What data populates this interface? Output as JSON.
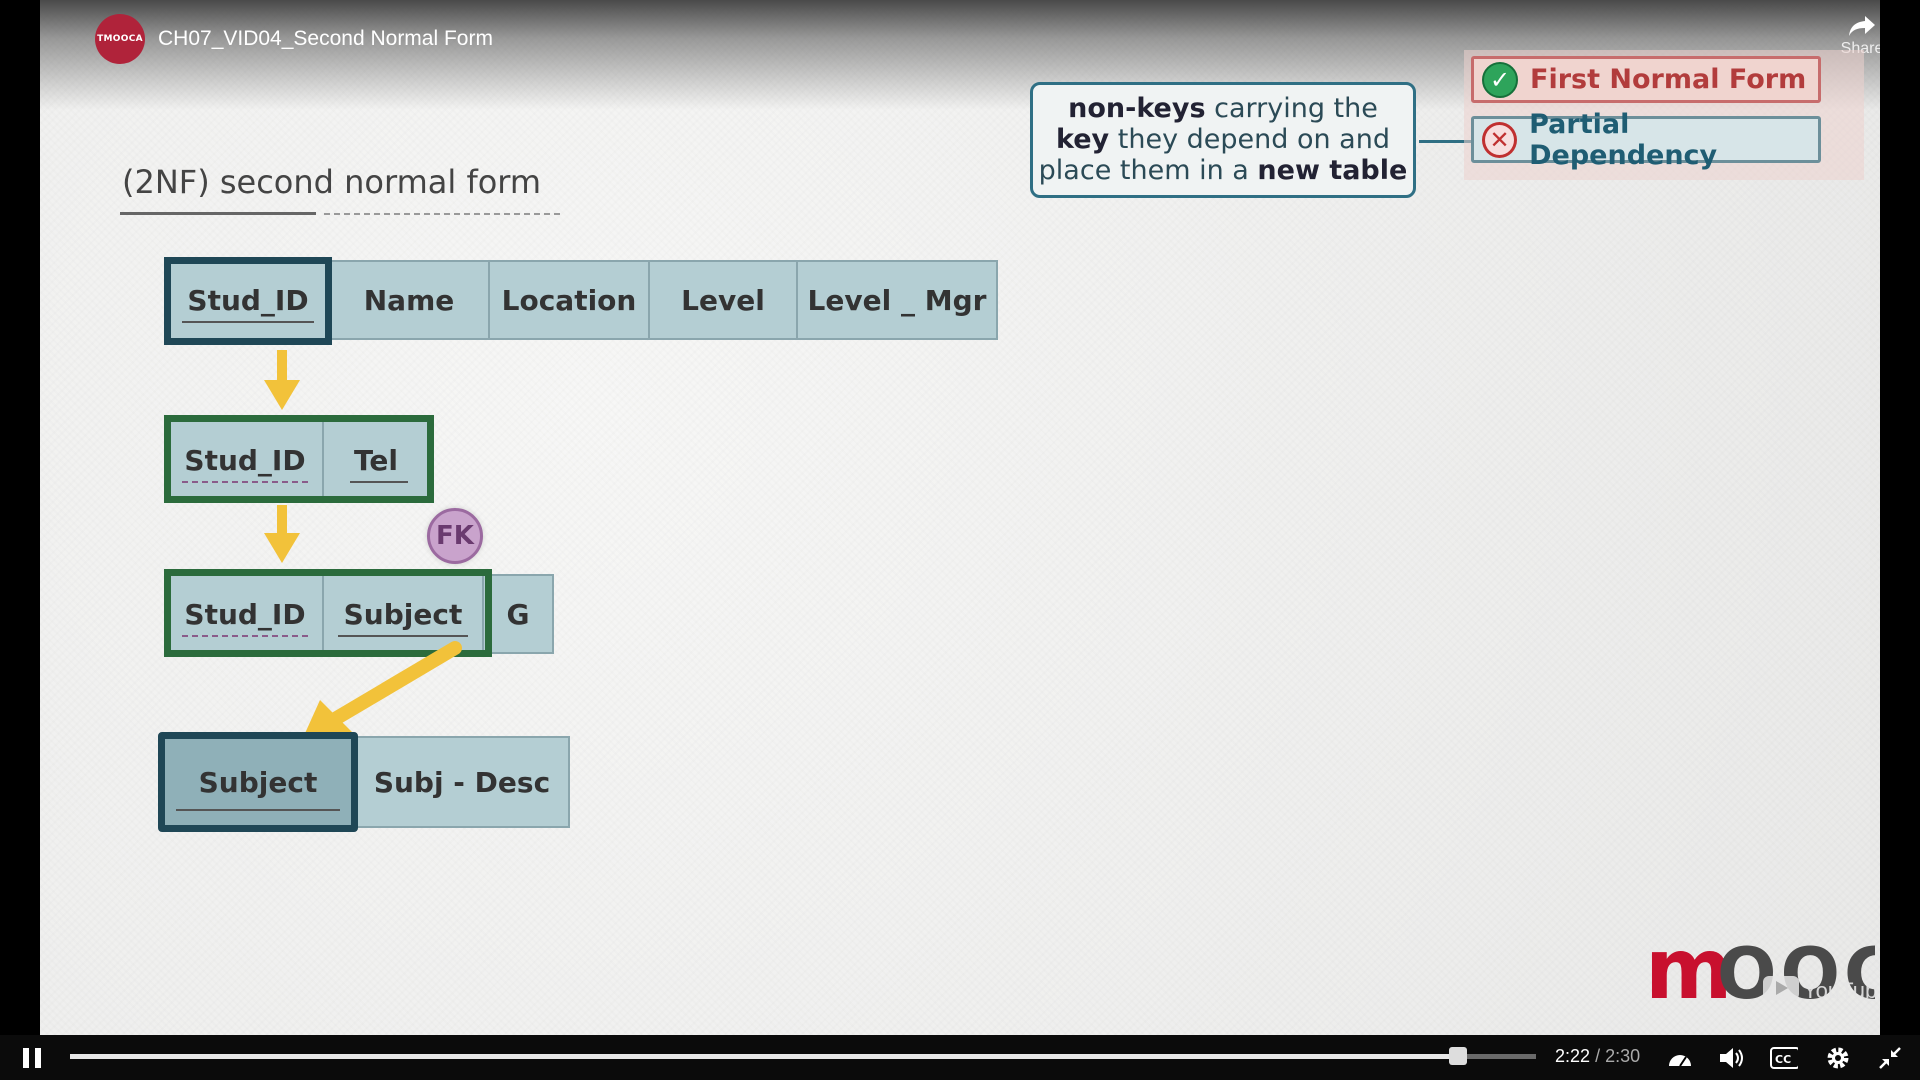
{
  "player": {
    "title": "CH07_VID04_Second Normal Form",
    "channel_logo_text": "TMOOCA",
    "share_label": "Share",
    "time_current": "2:22",
    "time_separator": "/",
    "time_total": "2:30",
    "progress_fraction": 0.9467
  },
  "slide": {
    "heading": "(2NF) second normal form",
    "callout": {
      "part1_bold": "non-keys",
      "part2": " carrying the",
      "part3_bold": "key",
      "part4": " they depend on and",
      "part5": "place them in a ",
      "part6_bold": "new table"
    },
    "badges": [
      {
        "label": "First Normal Form",
        "state": "check"
      },
      {
        "label": "Partial Dependency",
        "state": "cross"
      }
    ],
    "table_student": [
      "Stud_ID",
      "Name",
      "Location",
      "Level",
      "Level _ Mgr"
    ],
    "table_tel": [
      "Stud_ID",
      "Tel"
    ],
    "table_grade": [
      "Stud_ID",
      "Subject",
      "G"
    ],
    "table_subject": [
      "Subject",
      "Subj - Desc"
    ],
    "fk_label": "FK",
    "brand_text": "MOOCA",
    "watermark_text": "YouTube"
  },
  "colors": {
    "cell_fill": "#b4ced3",
    "key_border_dark": "#1f4756",
    "key_border_green": "#2b6b3c",
    "arrow": "#f2c23a",
    "brand_red": "#c8102e"
  }
}
